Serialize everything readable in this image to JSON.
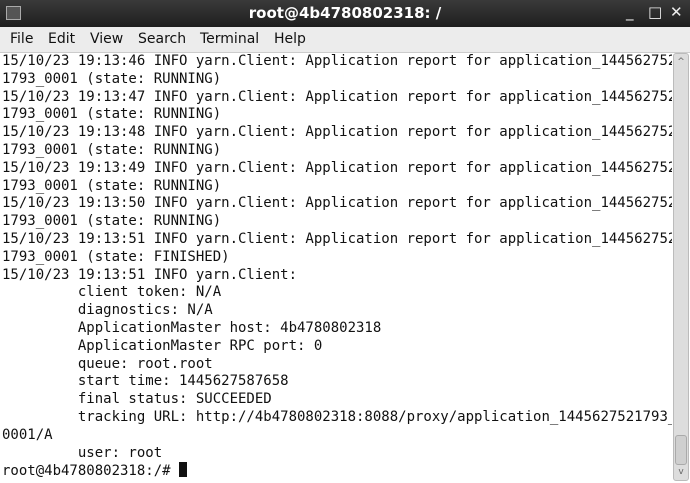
{
  "window": {
    "title": "root@4b4780802318: /",
    "minimize": "_",
    "maximize": "□",
    "close": "✕"
  },
  "menu": [
    "File",
    "Edit",
    "View",
    "Search",
    "Terminal",
    "Help"
  ],
  "lines": [
    "15/10/23 19:13:46 INFO yarn.Client: Application report for application_144562752",
    "1793_0001 (state: RUNNING)",
    "15/10/23 19:13:47 INFO yarn.Client: Application report for application_144562752",
    "1793_0001 (state: RUNNING)",
    "15/10/23 19:13:48 INFO yarn.Client: Application report for application_144562752",
    "1793_0001 (state: RUNNING)",
    "15/10/23 19:13:49 INFO yarn.Client: Application report for application_144562752",
    "1793_0001 (state: RUNNING)",
    "15/10/23 19:13:50 INFO yarn.Client: Application report for application_144562752",
    "1793_0001 (state: RUNNING)",
    "15/10/23 19:13:51 INFO yarn.Client: Application report for application_144562752",
    "1793_0001 (state: FINISHED)",
    "15/10/23 19:13:51 INFO yarn.Client:",
    "         client token: N/A",
    "         diagnostics: N/A",
    "         ApplicationMaster host: 4b4780802318",
    "         ApplicationMaster RPC port: 0",
    "         queue: root.root",
    "         start time: 1445627587658",
    "         final status: SUCCEEDED",
    "         tracking URL: http://4b4780802318:8088/proxy/application_1445627521793_",
    "0001/A",
    "         user: root"
  ],
  "prompt": "root@4b4780802318:/# ",
  "scroll": {
    "up": "^",
    "down": "v"
  }
}
